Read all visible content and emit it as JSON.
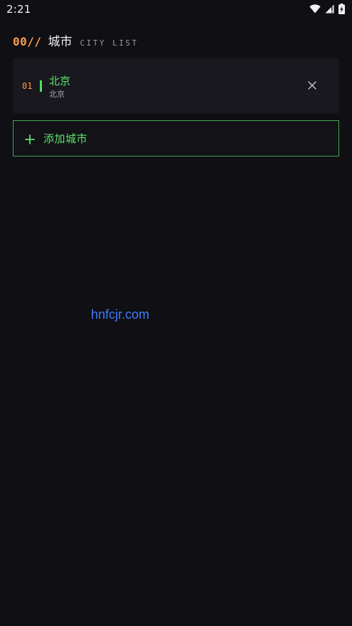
{
  "status_bar": {
    "time": "2:21",
    "icons": [
      "wifi-icon",
      "signal-icon",
      "battery-charging-icon"
    ]
  },
  "header": {
    "index": "00//",
    "title": "城市",
    "subtitle": "CITY LIST"
  },
  "cities": [
    {
      "index": "01",
      "name": "北京",
      "subtitle": "北京"
    }
  ],
  "add_button": {
    "icon": "plus-icon",
    "label": "添加城市"
  },
  "watermark": "hnfcjr.com",
  "colors": {
    "background": "#0f0f14",
    "card": "#18181e",
    "accent_orange": "#ff9b4a",
    "accent_green": "#5fe36c",
    "border_green": "#3fa84a",
    "watermark_blue": "#3d7bff"
  }
}
